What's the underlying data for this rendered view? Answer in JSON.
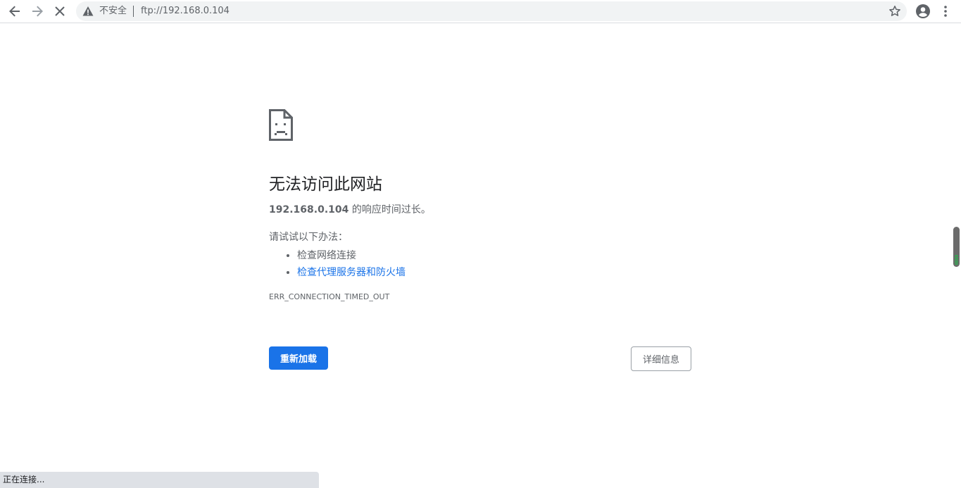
{
  "browser": {
    "security_label": "不安全",
    "url": "ftp://192.168.0.104",
    "icons": {
      "back": "back-arrow-icon",
      "forward": "forward-arrow-icon",
      "stop": "stop-icon",
      "warning": "warning-icon",
      "bookmark": "star-icon",
      "profile": "account-icon",
      "menu": "kebab-menu-icon"
    }
  },
  "error_page": {
    "title": "无法访问此网站",
    "host": "192.168.0.104",
    "message_suffix": " 的响应时间过长。",
    "try_label": "请试试以下办法：",
    "suggestions": [
      {
        "text": "检查网络连接"
      },
      {
        "text": "检查代理服务器和防火墙"
      }
    ],
    "error_code": "ERR_CONNECTION_TIMED_OUT",
    "reload_label": "重新加载",
    "details_label": "详细信息",
    "icon": "sad-page-icon",
    "colors": {
      "accent": "#1a73e8",
      "text": "#5f6368",
      "heading": "#202124"
    }
  },
  "status": {
    "text": "正在连接..."
  }
}
